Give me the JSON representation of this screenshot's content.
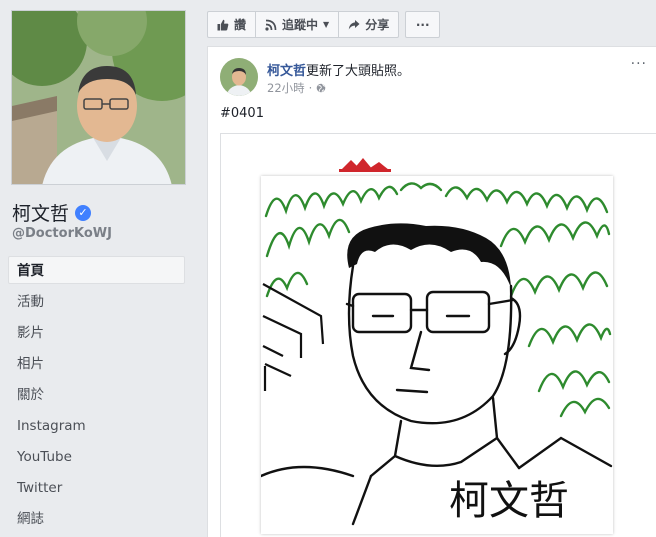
{
  "profile": {
    "name": "柯文哲",
    "handle": "@DoctorKoWJ"
  },
  "nav": {
    "items": [
      {
        "label": "首頁",
        "active": true
      },
      {
        "label": "活動",
        "active": false
      },
      {
        "label": "影片",
        "active": false
      },
      {
        "label": "相片",
        "active": false
      },
      {
        "label": "關於",
        "active": false
      },
      {
        "label": "Instagram",
        "active": false
      },
      {
        "label": "YouTube",
        "active": false
      },
      {
        "label": "Twitter",
        "active": false
      },
      {
        "label": "網誌",
        "active": false
      }
    ]
  },
  "actions": {
    "like": "讚",
    "follow": "追蹤中",
    "share": "分享"
  },
  "post": {
    "author": "柯文哲",
    "action_text": "更新了大頭貼照。",
    "time": "22小時",
    "text": "#0401",
    "signature": "柯文哲"
  },
  "colors": {
    "link": "#365899",
    "page_bg": "#e9ebee",
    "sketch_green": "#2e8b2e",
    "logo_red": "#d0262c"
  }
}
